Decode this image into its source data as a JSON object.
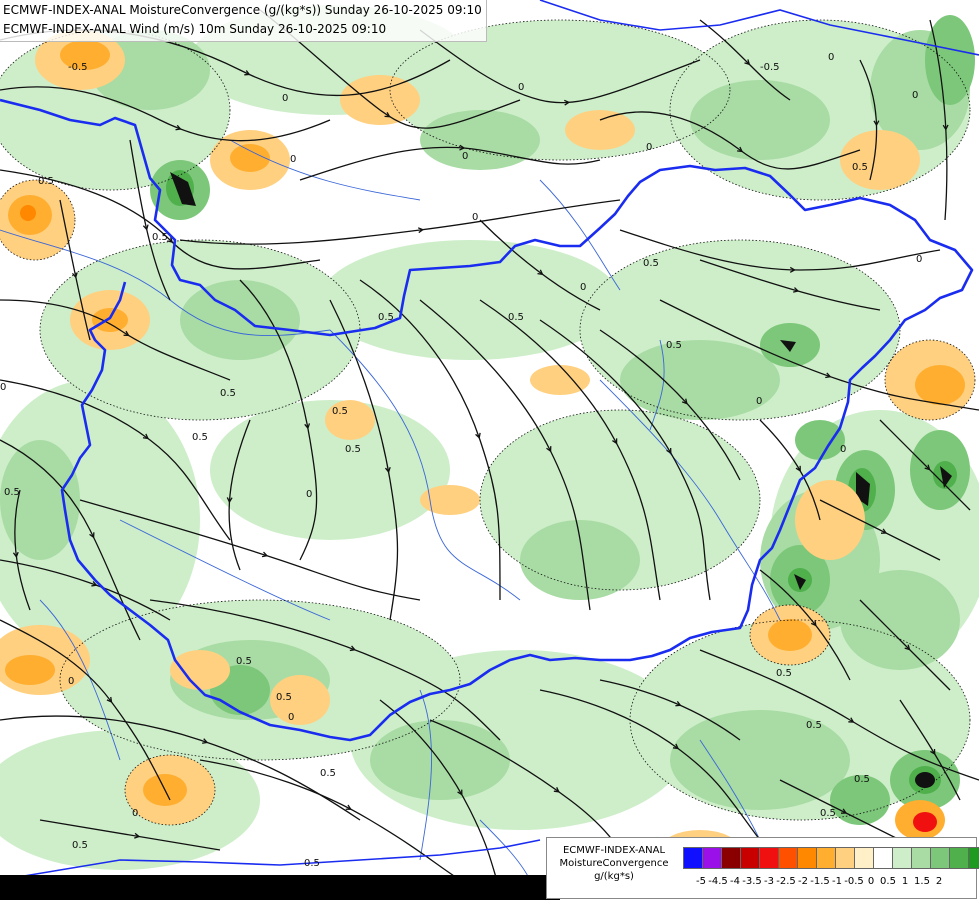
{
  "title": {
    "line1": "ECMWF-INDEX-ANAL MoistureConvergence (g/(kg*s)) Sunday 26-10-2025 09:10",
    "line2": "ECMWF-INDEX-ANAL Wind (m/s) 10m Sunday 26-10-2025 09:10"
  },
  "legend": {
    "line1": "ECMWF-INDEX-ANAL",
    "line2": "MoistureConvergence",
    "line3": "g/(kg*s)",
    "swatches": [
      "#1010ff",
      "#9a10e8",
      "#8a0000",
      "#c80000",
      "#f01010",
      "#ff5000",
      "#ff8800",
      "#ffae30",
      "#ffd080",
      "#fff0c8",
      "#ffffff",
      "#cdeec9",
      "#a8dca4",
      "#7cc77a",
      "#4fb04c",
      "#1f9a20"
    ],
    "ticks": [
      "-5",
      "-4.5",
      "-4",
      "-3.5",
      "-3",
      "-2.5",
      "-2",
      "-1.5",
      "-1",
      "-0.5",
      "0",
      "0.5",
      "1",
      "1.5",
      "2"
    ]
  },
  "contour_labels": [
    "0",
    "0.5",
    "-0.5",
    "0.5",
    "0",
    "0",
    "0.5",
    "0",
    "0",
    "0.5",
    "0",
    "0.5",
    "-0.5",
    "0",
    "0.5",
    "0",
    "0.5",
    "0.5",
    "0",
    "0.5",
    "0.5",
    "0",
    "0.5",
    "0",
    "0",
    "0.5",
    "0",
    "0.5",
    "0.5",
    "0",
    "0.5",
    "0",
    "0.5",
    "0.5",
    "0.5",
    "0.5",
    "0.5",
    "0.5",
    "0",
    "0"
  ],
  "colors": {
    "border": "#1a2cf0",
    "river": "#3a66d8",
    "streamline": "#111111",
    "green_light": "#cdeec9",
    "green_mid": "#a8dca4",
    "green_dark": "#7cc77a",
    "green_deep": "#4fb04c",
    "orange_light": "#ffd080",
    "orange_mid": "#ffae30",
    "orange_dark": "#ff8800"
  }
}
